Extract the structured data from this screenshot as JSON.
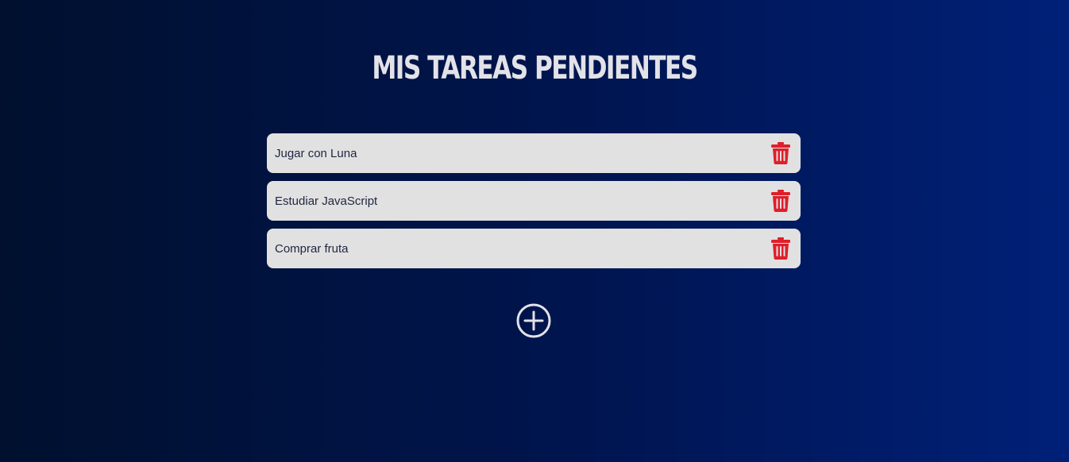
{
  "page": {
    "title": "MIS TAREAS PENDIENTES"
  },
  "tasks": [
    {
      "text": "Jugar con Luna",
      "action_icon": "trash-icon"
    },
    {
      "text": "Estudiar JavaScript",
      "action_icon": "trash-icon"
    },
    {
      "text": "Comprar fruta",
      "action_icon": "trash-icon"
    }
  ],
  "add_button": {
    "icon": "plus-circle-icon"
  },
  "colors": {
    "background_start": "#00102e",
    "background_end": "#002078",
    "title": "#e2e2e8",
    "task_background": "#e1e1e1",
    "task_text": "#1f2540",
    "delete_icon": "#e01e2b",
    "add_icon": "#e2e2e8"
  }
}
